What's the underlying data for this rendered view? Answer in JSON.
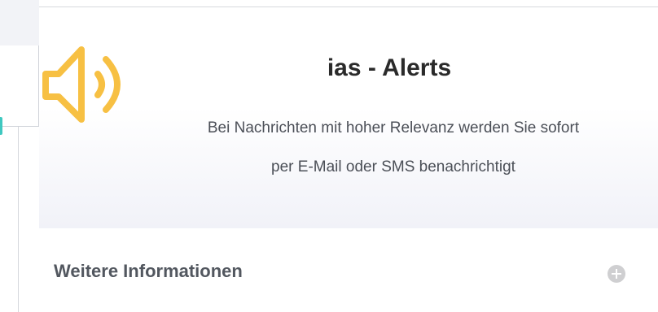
{
  "card": {
    "title": "ias - Alerts",
    "description_line1": "Bei Nachrichten mit hoher Relevanz werden Sie sofort",
    "description_line2": "per E-Mail oder SMS benachrichtigt",
    "icon": "speaker-icon",
    "accent_color": "#f7c043"
  },
  "more_info": {
    "label": "Weitere Informationen",
    "icon": "plus-circle-icon"
  }
}
